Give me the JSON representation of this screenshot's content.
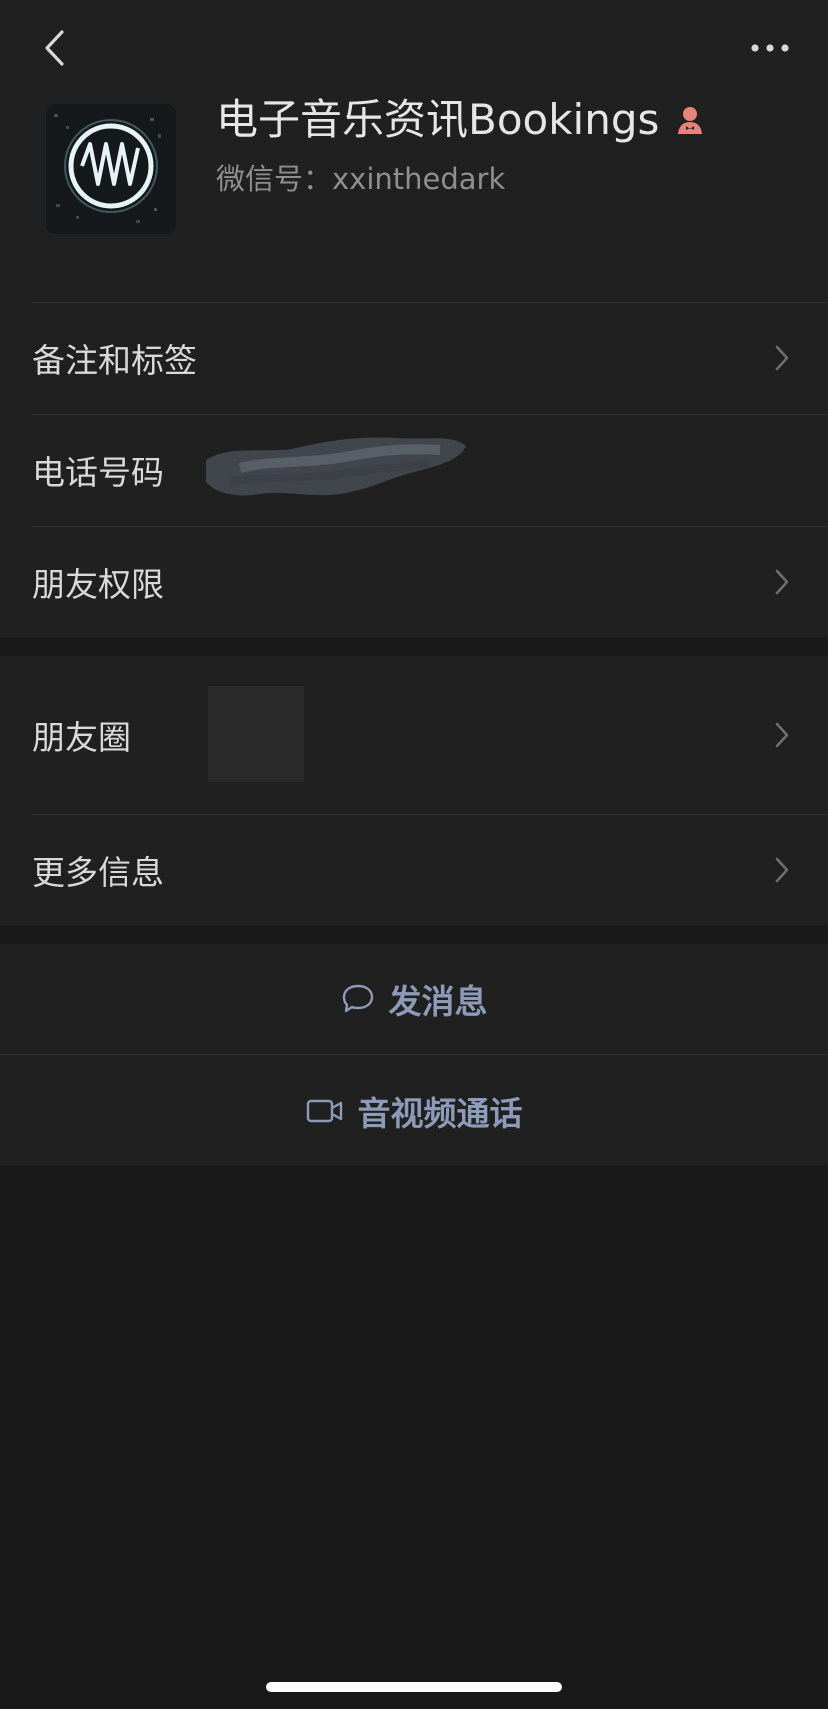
{
  "header": {
    "back_icon": "chevron-left-icon",
    "more_icon": "more-dots-icon"
  },
  "profile": {
    "name": "电子音乐资讯Bookings",
    "gender_icon": "female-gender-icon",
    "gender_color": "#e8837a",
    "wechat_id": "微信号：xxinthedark"
  },
  "rows_group1": [
    {
      "label": "备注和标签",
      "has_chevron": true
    },
    {
      "label": "电话号码",
      "has_chevron": false
    },
    {
      "label": "朋友权限",
      "has_chevron": true
    }
  ],
  "rows_group2": [
    {
      "label": "朋友圈",
      "has_chevron": true
    },
    {
      "label": "更多信息",
      "has_chevron": true
    }
  ],
  "actions": {
    "message_label": "发消息",
    "call_label": "音视频通话",
    "accent_color": "#8b9bb8"
  }
}
